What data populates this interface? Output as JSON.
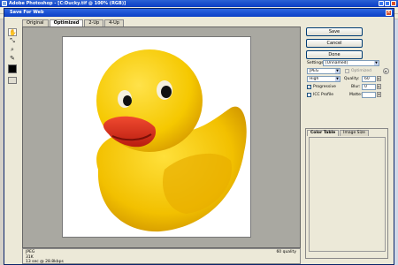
{
  "photoshop": {
    "title": "Adobe Photoshop - [C:Ducky.tif @ 100% (RGB)]"
  },
  "dialog": {
    "title": "Save For Web",
    "close_glyph": "×"
  },
  "tabs": [
    {
      "label": "Original"
    },
    {
      "label": "Optimized"
    },
    {
      "label": "2-Up"
    },
    {
      "label": "4-Up"
    }
  ],
  "actions": {
    "save": "Save",
    "cancel": "Cancel",
    "done": "Done"
  },
  "settings": {
    "settings_label": "Settings:",
    "settings_value": "[Unnamed]",
    "format": "JPEG",
    "quality_preset": "High",
    "quality_label": "Quality:",
    "quality_value": "60",
    "optimized_label": "Optimized",
    "progressive_label": "Progressive",
    "progressive_checked": true,
    "icc_label": "ICC Profile",
    "icc_checked": false,
    "blur_label": "Blur:",
    "blur_value": "0",
    "matte_label": "Matte:",
    "matte_value": ""
  },
  "color_panel": {
    "tabs": [
      "Color Table",
      "Image Size"
    ]
  },
  "status": {
    "format": "JPEG",
    "size": "31K",
    "time": "13 sec @ 28.8kbps",
    "quality": "60 quality"
  },
  "colors": {
    "duck_body": "#f5c800",
    "duck_shadow": "#e0a400",
    "beak": "#e8301f",
    "dialog_title": "#0b3fc5"
  }
}
